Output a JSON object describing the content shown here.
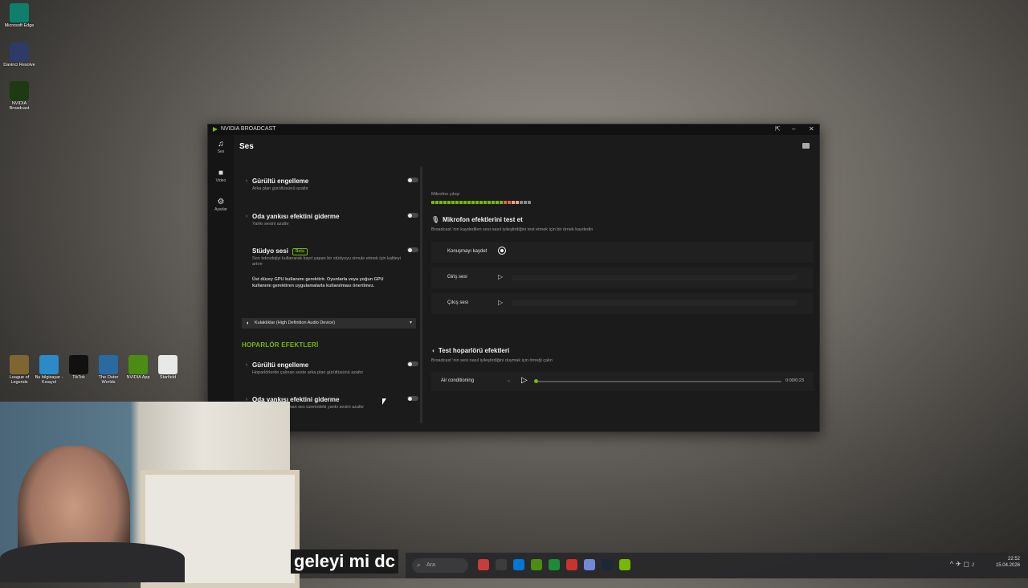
{
  "desktop": {
    "icons": [
      {
        "label": "Microsoft Edge",
        "color": "#0d7f6b"
      },
      {
        "label": "Davinci Resolve",
        "color": "#2d3c66"
      },
      {
        "label": "NVIDIA Broadcast",
        "color": "#1d3a12"
      },
      {
        "label": "League of Legends",
        "color": "#7f6630"
      },
      {
        "label": "Bu bilgisayar - Kısayol",
        "color": "#2c8ac8"
      },
      {
        "label": "TikTok",
        "color": "#111111"
      },
      {
        "label": "The Outer Worlds",
        "color": "#2a6aa0"
      },
      {
        "label": "NVIDIA App",
        "color": "#4b8d12"
      },
      {
        "label": "Starfield",
        "color": "#e8e8e8"
      }
    ]
  },
  "caption": {
    "text": "geleyi mi dc"
  },
  "taskbar": {
    "search_placeholder": "Ara",
    "apps": [
      "#c83c3c",
      "#3d3d3d",
      "#0078d4",
      "#4b8d12",
      "#1e8a3a",
      "#c8342c",
      "#7289da",
      "#1b2838",
      "#76b900"
    ],
    "time": "22:52",
    "date": "15.04.2026",
    "tray_icons": "^ ✈ ◻ ♪"
  },
  "window": {
    "title": "NVIDIA BROADCAST",
    "rail": {
      "audio": "Ses",
      "video": "Video",
      "settings": "Ayarlar"
    },
    "page_title": "Ses",
    "mic_effects": [
      {
        "name": "Gürültü engelleme",
        "desc": "Arka plan gürültüsünü azaltır"
      },
      {
        "name": "Oda yankısı efektini giderme",
        "desc": "Yankı sesini azaltır"
      }
    ],
    "studio": {
      "name": "Stüdyo sesi",
      "badge": "Beta",
      "desc": "Son teknolojiyi kullanarak kayıt yapan bir stüdyoyu simule etmek için kaliteyi artırır",
      "warning": "Üst düzey GPU kullanımı gerektirir. Oyunlarla veya yoğun GPU kullanımı gerektiren uygulamalarla kullanılması önerilmez."
    },
    "device": "Kulaklıklar (High Definition Audio Device)",
    "speaker_section": "HOPARLÖR EFEKTLERİ",
    "speaker_effects": [
      {
        "name": "Gürültü engelleme",
        "desc": "Hoparlörlerde çalınan seste arka plan gürültüsünü azaltır"
      },
      {
        "name": "Oda yankısı efektini giderme",
        "desc": "Hoparlörlerden çalınan ses üzerindeki yankı sesini azaltır"
      }
    ],
    "mic_output_label": "Mikrofon çıkışı",
    "meter_colors": [
      "#76b900",
      "#76b900",
      "#76b900",
      "#76b900",
      "#76b900",
      "#76b900",
      "#76b900",
      "#76b900",
      "#76b900",
      "#76b900",
      "#76b900",
      "#76b900",
      "#76b900",
      "#76b900",
      "#76b900",
      "#76b900",
      "#76b900",
      "#76b900",
      "#e06040",
      "#e06040",
      "#e8a090",
      "#e8a090",
      "#888888",
      "#888888",
      "#888888"
    ],
    "mic_test": {
      "title": "Mikrofon efektlerini test et",
      "desc": "Broadcast 'nin kaydedilen sesi nasıl iyileştirdiğini test etmek için bir örnek kaydedin",
      "record_label": "Konuşmayı kaydet",
      "input_label": "Giriş sesi",
      "output_label": "Çıkış sesi"
    },
    "speaker_test": {
      "title": "Test hoparlörü efektleri",
      "desc": "Broadcast 'nin sesi nasıl iyileştirdiğini duymak için örneği çalın",
      "sample": "Air conditioning",
      "time": "0:00/0:23",
      "progress": 0.0
    }
  }
}
